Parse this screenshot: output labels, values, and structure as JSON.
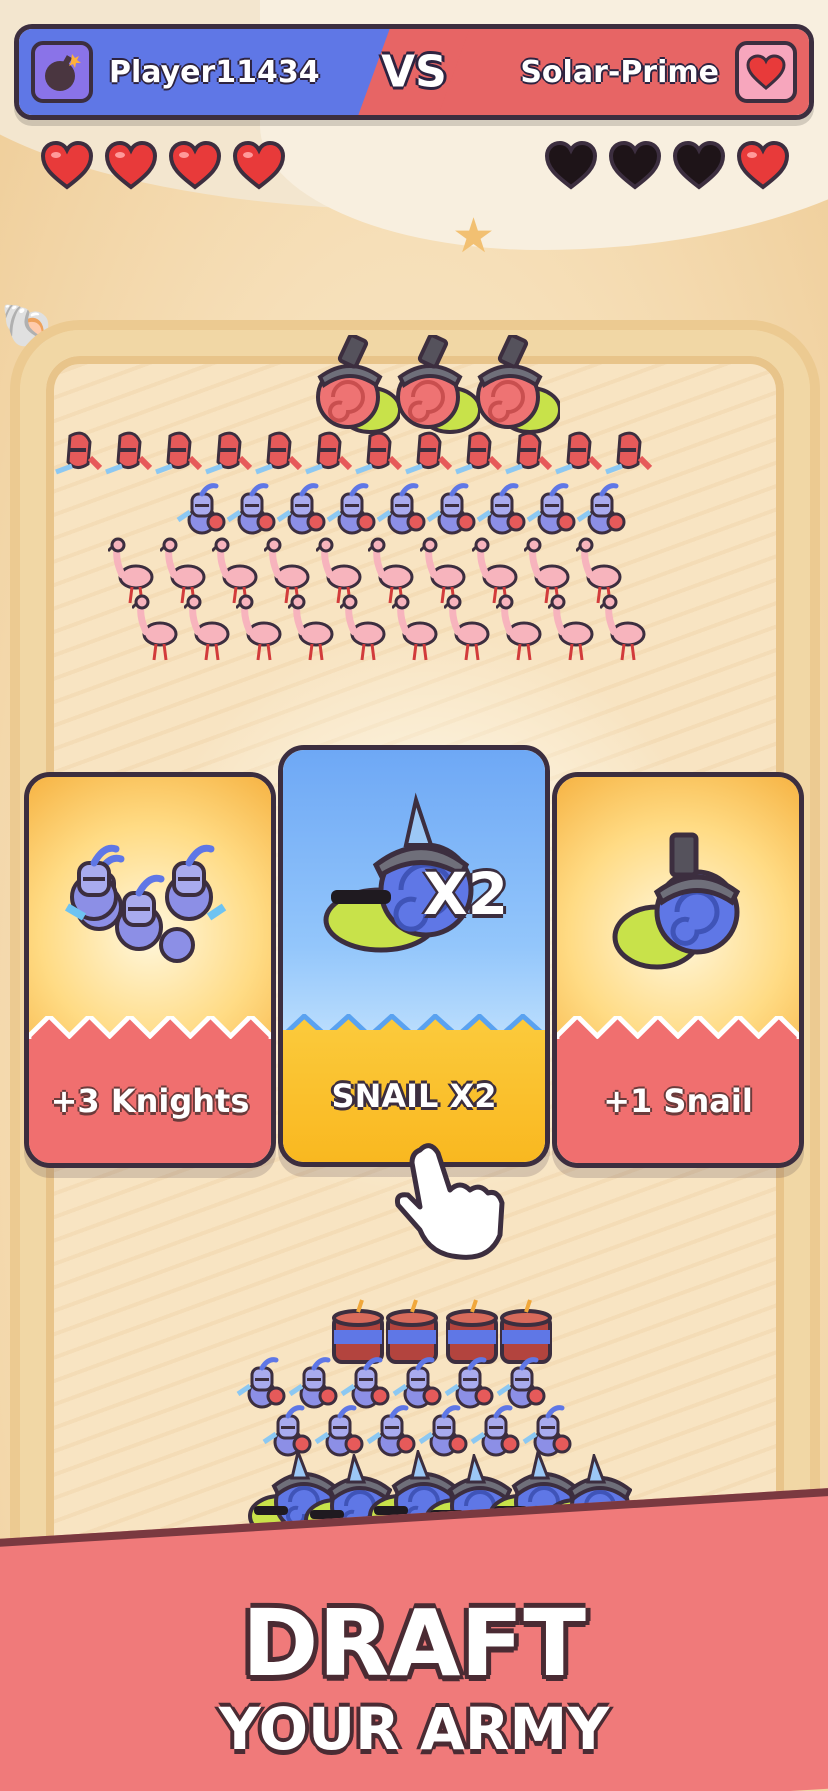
{
  "hud": {
    "player_name": "Player11434",
    "player_avatar_icon": "bomb-icon",
    "vs_label": "VS",
    "opponent_name": "Solar-Prime",
    "opponent_avatar_icon": "heart-icon",
    "player_hearts_remaining": 4,
    "player_hearts_total": 4,
    "opponent_hearts_remaining": 1,
    "opponent_hearts_total": 4
  },
  "enemy_army": {
    "snail_cannons": 3,
    "shrimp_swordsmen": 12,
    "knights": 9,
    "flamingos": 20
  },
  "player_army": {
    "tnt_barrels": 4,
    "knights": 12,
    "snails": 6
  },
  "cards": [
    {
      "label": "+3 Knights",
      "theme": "red"
    },
    {
      "label": "SNAIL X2",
      "badge": "X2",
      "theme": "yellow",
      "selected": true
    },
    {
      "label": "+1 Snail",
      "theme": "red"
    }
  ],
  "banner": {
    "line1": "DRAFT",
    "line2": "YOUR ARMY"
  },
  "colors": {
    "player_blue": "#5f77e6",
    "opponent_red": "#e76565",
    "heart_red": "#e83a3a",
    "heart_lost": "#1e1418",
    "banner_pink": "#f07a7a"
  }
}
